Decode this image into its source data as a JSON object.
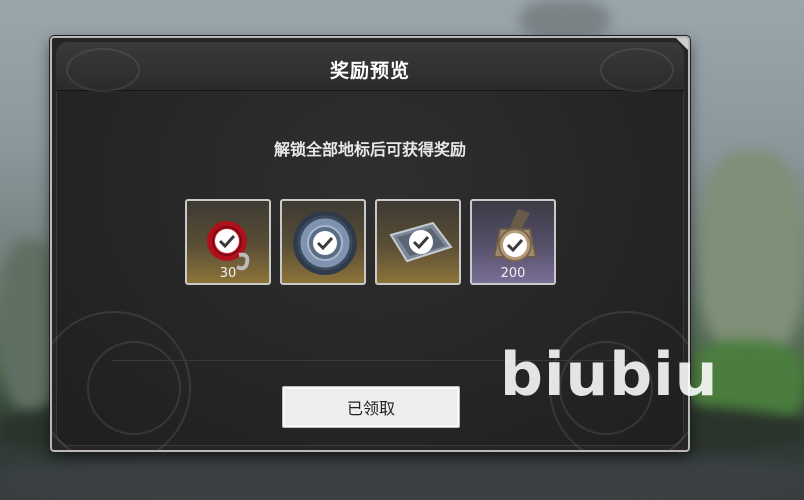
{
  "dialog": {
    "title": "奖励预览",
    "subtitle": "解锁全部地标后可获得奖励",
    "claim_button_label": "已领取"
  },
  "rewards": [
    {
      "icon": "red-chain-token-icon",
      "quantity": "30",
      "rarity_color": "#8d7339",
      "claimed": true
    },
    {
      "icon": "blue-gear-medallion-icon",
      "quantity": "",
      "rarity_color": "#8d7339",
      "claimed": true
    },
    {
      "icon": "metal-plate-icon",
      "quantity": "",
      "rarity_color": "#8d7339",
      "claimed": true
    },
    {
      "icon": "bronze-medal-icon",
      "quantity": "200",
      "rarity_color": "#7a6f98",
      "claimed": true
    }
  ],
  "watermark": "biubiu"
}
